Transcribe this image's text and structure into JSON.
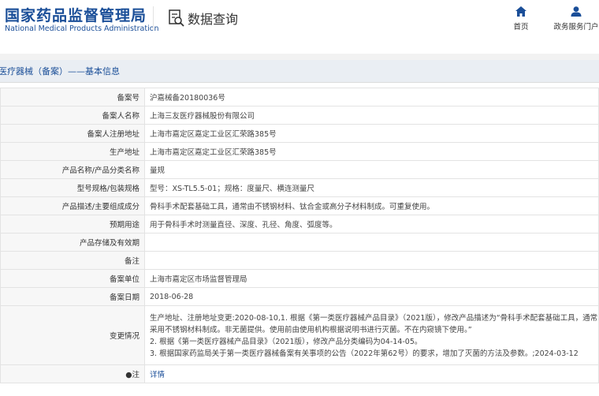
{
  "header": {
    "logo_cn": "国家药品监督管理局",
    "logo_en": "National Medical Products Administration",
    "query_title": "数据查询",
    "nav": {
      "home": "首页",
      "portal": "政务服务门户"
    }
  },
  "breadcrumb": "医疗器械（备案）——基本信息",
  "rows": [
    {
      "label": "备案号",
      "value": "沪嘉械备20180036号"
    },
    {
      "label": "备案人名称",
      "value": "上海三友医疗器械股份有限公司"
    },
    {
      "label": "备案人注册地址",
      "value": "上海市嘉定区嘉定工业区汇荣路385号"
    },
    {
      "label": "生产地址",
      "value": "上海市嘉定区嘉定工业区汇荣路385号"
    },
    {
      "label": "产品名称/产品分类名称",
      "value": "量规"
    },
    {
      "label": "型号规格/包装规格",
      "value": "型号：XS-TL5.5-01；规格：度量尺、横连测量尺"
    },
    {
      "label": "产品描述/主要组成成分",
      "value": "骨科手术配套基础工具，通常由不锈钢材料、钛合金或高分子材料制成。可重复使用。"
    },
    {
      "label": "预期用途",
      "value": "用于骨科手术时测量直径、深度、孔径、角度、弧度等。"
    },
    {
      "label": "产品存储及有效期",
      "value": ""
    },
    {
      "label": "备注",
      "value": ""
    },
    {
      "label": "备案单位",
      "value": "上海市嘉定区市场监督管理局"
    },
    {
      "label": "备案日期",
      "value": "2018-06-28"
    }
  ],
  "change": {
    "label": "变更情况",
    "lines": [
      "生产地址、注册地址变更:2020-08-10,1. 根据《第一类医疗器械产品目录》（2021版），修改产品描述为“骨科手术配套基础工具，通常由",
      "采用不锈钢材料制成。非无菌提供。使用前由使用机构根据说明书进行灭菌。不在内窥镜下使用。”",
      "2. 根据《第一类医疗器械产品目录》（2021版），修改产品分类编码为04-14-05。",
      "3. 根据国家药监局关于第一类医疗器械备案有关事项的公告（2022年第62号）的要求，增加了灭菌的方法及参数。;2024-03-12"
    ]
  },
  "note": {
    "label": "注",
    "link": "详情"
  }
}
